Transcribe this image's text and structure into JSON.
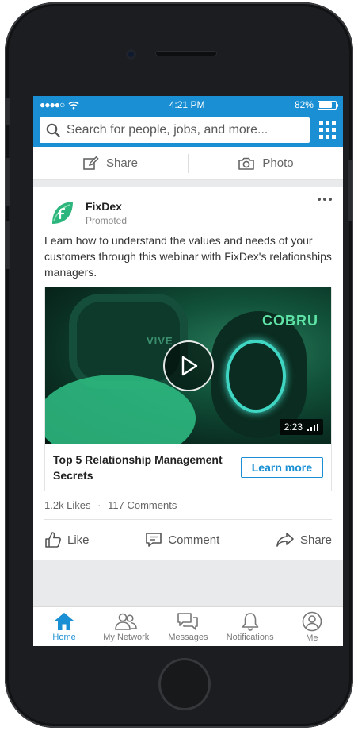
{
  "status_bar": {
    "time": "4:21 PM",
    "battery_percent": "82%",
    "battery_level": 0.82
  },
  "search": {
    "placeholder": "Search for people, jobs, and more..."
  },
  "share_bar": {
    "share_label": "Share",
    "photo_label": "Photo"
  },
  "post": {
    "author": "FixDex",
    "subtitle": "Promoted",
    "text": "Learn how to understand the values and needs of your customers through this webinar with FixDex's relationships managers.",
    "video_duration": "2:23",
    "video_overlay_text": "COBRU",
    "video_headset_text": "VIVE",
    "ad_title": "Top 5 Relationship Management Secrets",
    "cta_label": "Learn more",
    "likes": "1.2k Likes",
    "comments": "117 Comments",
    "separator": "·",
    "actions": {
      "like": "Like",
      "comment": "Comment",
      "share": "Share"
    }
  },
  "tabs": [
    {
      "label": "Home",
      "icon": "home-icon",
      "active": true
    },
    {
      "label": "My Network",
      "icon": "network-icon",
      "active": false
    },
    {
      "label": "Messages",
      "icon": "messages-icon",
      "active": false
    },
    {
      "label": "Notifications",
      "icon": "bell-icon",
      "active": false
    },
    {
      "label": "Me",
      "icon": "user-icon",
      "active": false
    }
  ],
  "colors": {
    "brand": "#1a8fd3",
    "logo_green": "#2cb67d"
  }
}
